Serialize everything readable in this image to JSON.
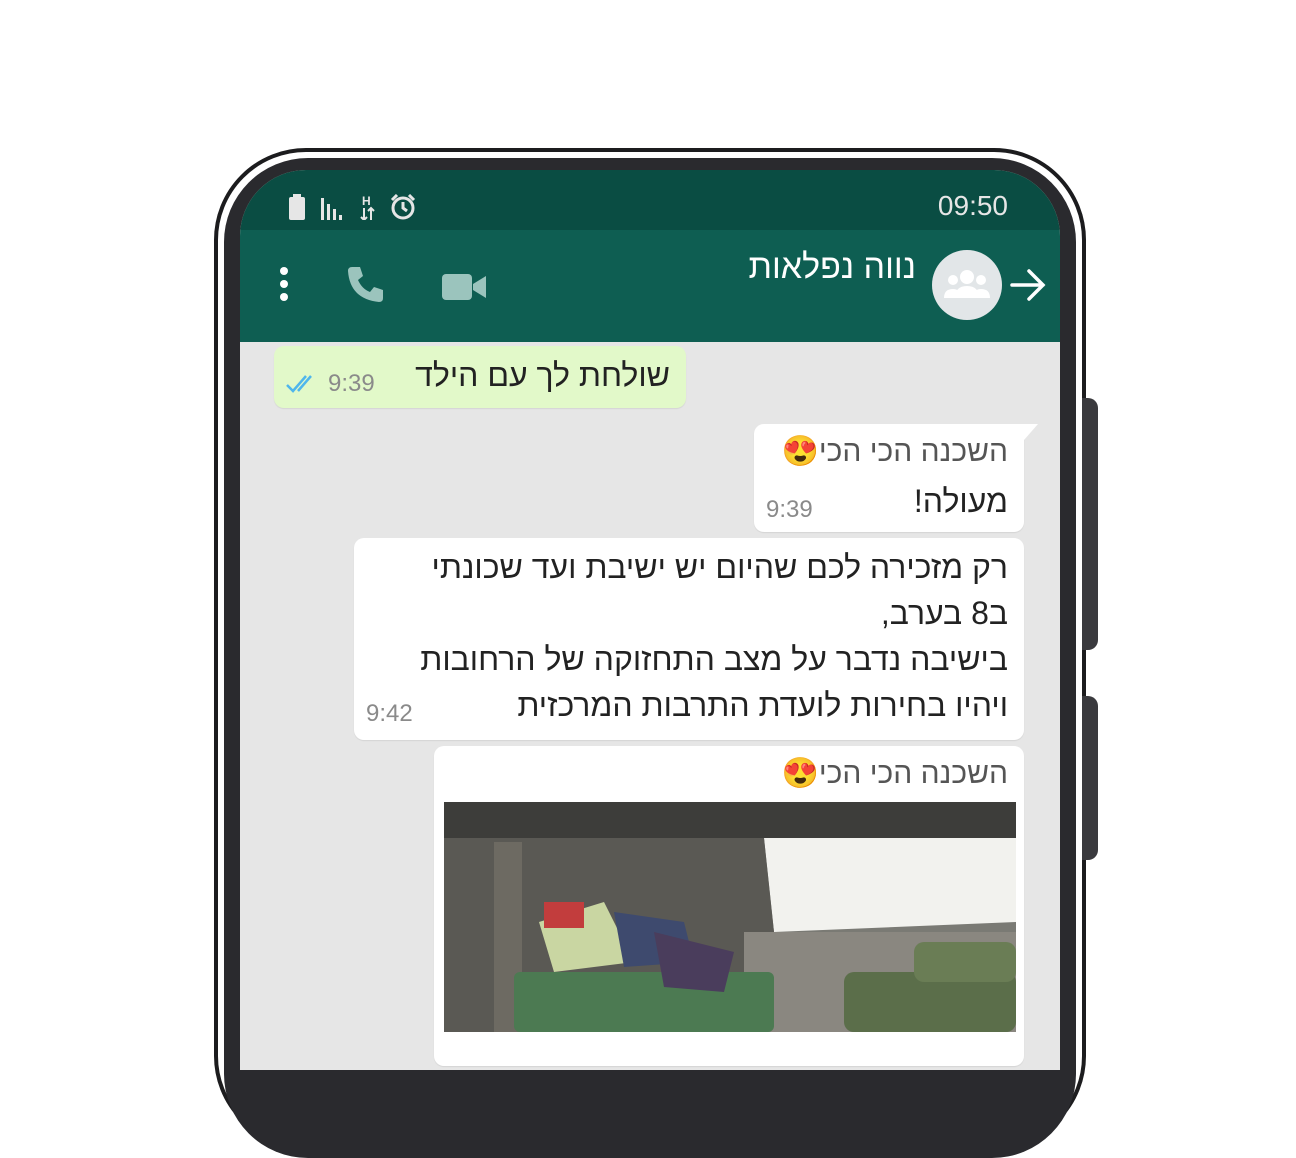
{
  "status_bar": {
    "time": "09:50",
    "icons": [
      "battery-icon",
      "signal-icon",
      "data-icon",
      "alarm-icon"
    ]
  },
  "header": {
    "title": "נווה נפלאות",
    "icons": [
      "back-arrow-icon",
      "group-avatar-icon",
      "video-call-icon",
      "phone-call-icon",
      "more-options-icon"
    ]
  },
  "messages": [
    {
      "type": "outgoing",
      "text": "שולחת לך עם הילד",
      "time": "9:39",
      "status": "read"
    },
    {
      "type": "incoming",
      "sender": "השכנה הכי הכי😍",
      "text": "מעולה!",
      "time": "9:39"
    },
    {
      "type": "incoming",
      "lines": [
        "רק מזכירה לכם שהיום יש ישיבת ועד שכונתי",
        "ב8 בערב,",
        "בישיבה נדבר על מצב התחזוקה של הרחובות",
        "ויהיו בחירות לועדת התרבות המרכזית"
      ],
      "time": "9:42"
    },
    {
      "type": "incoming",
      "sender": "השכנה הכי הכי😍",
      "media": "photo"
    }
  ],
  "colors": {
    "header": "#0e5e52",
    "status_bar": "#0a4d43",
    "outgoing_bubble": "#e2f9c9",
    "incoming_bubble": "#ffffff",
    "chat_background": "#e6e6e6",
    "read_ticks": "#4fb6ec"
  }
}
